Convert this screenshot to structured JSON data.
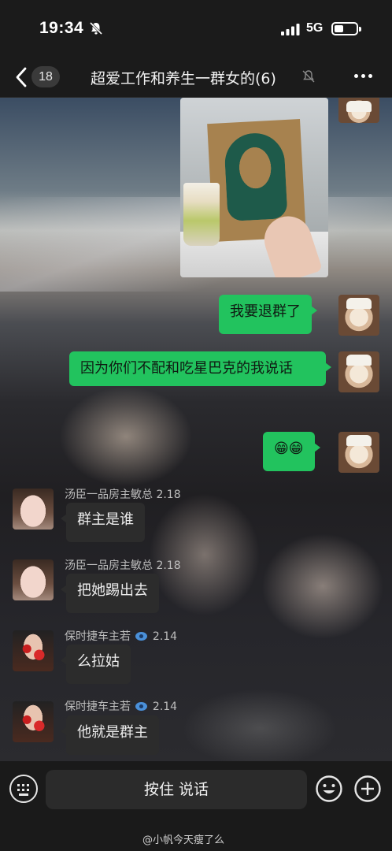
{
  "status_bar": {
    "time": "19:34",
    "network": "5G"
  },
  "nav": {
    "back_count": "18",
    "title": "超爱工作和养生一群女的(6)"
  },
  "messages": [
    {
      "type": "image",
      "from": "me"
    },
    {
      "type": "text",
      "from": "me",
      "text": "我要退群了"
    },
    {
      "type": "text",
      "from": "me",
      "text": "因为你们不配和吃星巴克的我说话"
    },
    {
      "type": "text",
      "from": "me",
      "text": "😁😁"
    },
    {
      "type": "text",
      "from": "other",
      "sender": "汤臣一品房主敏总 2.18",
      "text": "群主是谁"
    },
    {
      "type": "text",
      "from": "other",
      "sender": "汤臣一品房主敏总 2.18",
      "text": "把她踢出去"
    },
    {
      "type": "text",
      "from": "other",
      "sender_name": "保时捷车主若",
      "sender_suffix": "2.14",
      "text": "么拉姑"
    },
    {
      "type": "text",
      "from": "other",
      "sender_name": "保时捷车主若",
      "sender_suffix": "2.14",
      "text": "他就是群主"
    }
  ],
  "input_bar": {
    "hold_to_talk_label": "按住 说话"
  },
  "watermark": {
    "text": "@小帆今天瘦了么"
  },
  "colors": {
    "sent_bubble": "#22c35e",
    "received_bubble": "#2c2c2c",
    "bar_background": "#1b1b1b"
  },
  "icons": [
    "bell-off-icon",
    "signal-icon",
    "battery-icon",
    "back-icon",
    "mute-icon",
    "more-icon",
    "keyboard-icon",
    "emoji-icon",
    "plus-icon",
    "weibo-logo-icon"
  ]
}
